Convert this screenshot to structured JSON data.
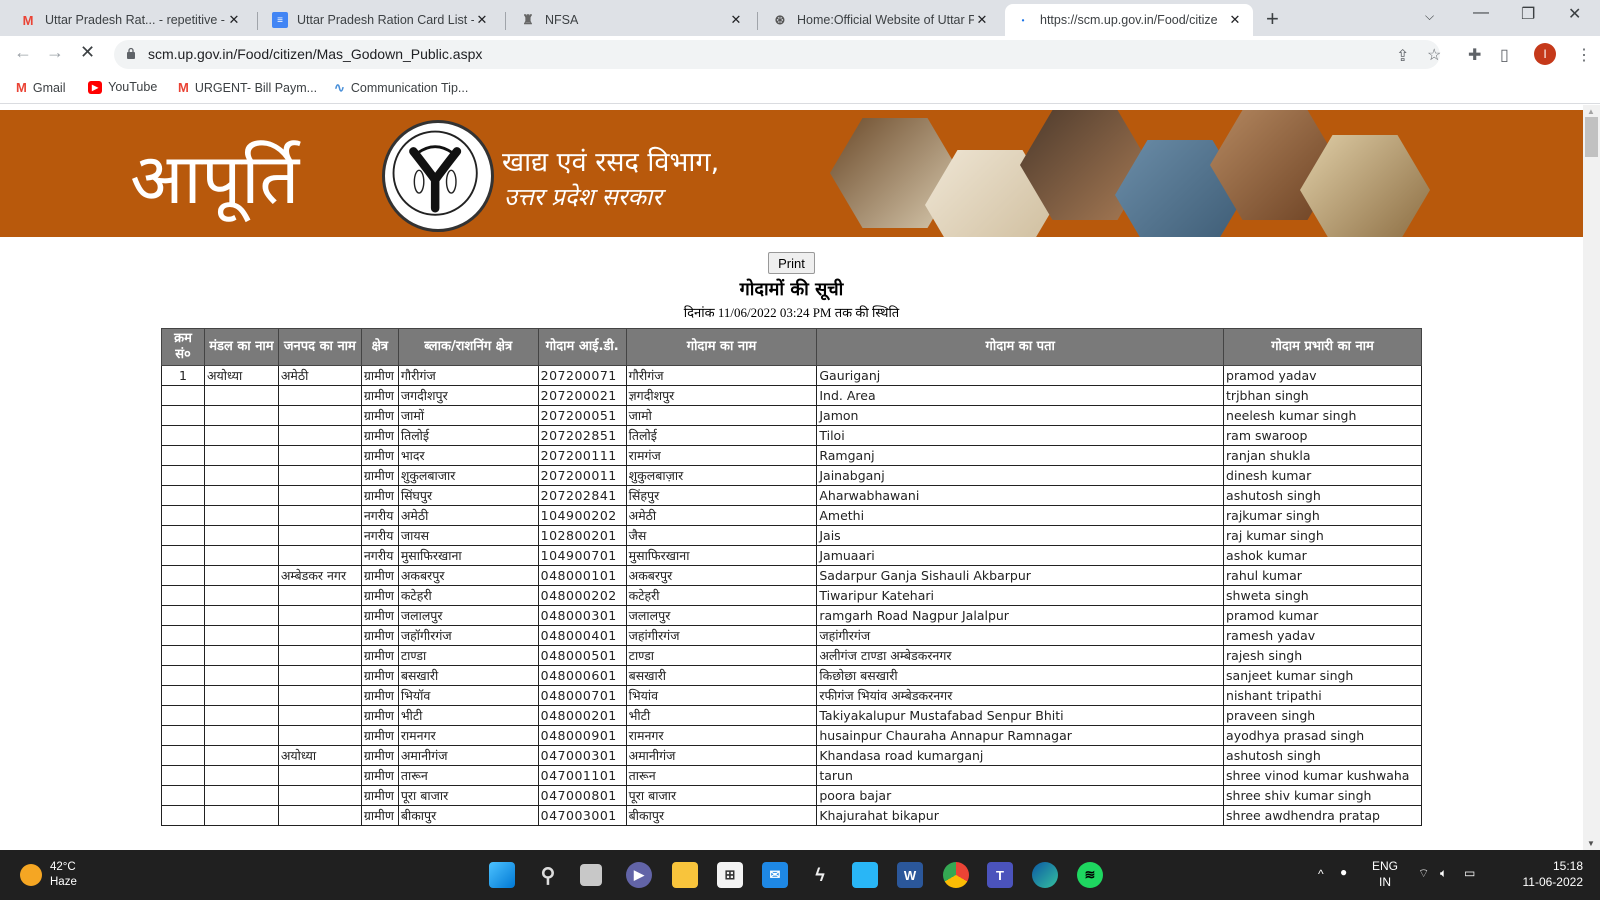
{
  "browser": {
    "tabs": [
      {
        "title": "Uttar Pradesh Rat... - repetitive -",
        "icon": "gmail-icon",
        "active": false
      },
      {
        "title": "Uttar Pradesh Ration Card List - (",
        "icon": "docs-icon",
        "active": false
      },
      {
        "title": "NFSA",
        "icon": "emblem-icon",
        "active": false
      },
      {
        "title": "Home:Official Website of Uttar Pr",
        "icon": "up-emblem-icon",
        "active": false
      },
      {
        "title": "https://scm.up.gov.in/Food/citize",
        "icon": "loading-icon",
        "active": true
      }
    ],
    "new_tab": "+",
    "url": "scm.up.gov.in/Food/citizen/Mas_Godown_Public.aspx",
    "profile_initial": "I",
    "bookmarks": [
      {
        "label": "Gmail",
        "icon": "gmail-icon"
      },
      {
        "label": "YouTube",
        "icon": "youtube-icon"
      },
      {
        "label": "URGENT- Bill Paym...",
        "icon": "gmail-icon"
      },
      {
        "label": "Communication Tip...",
        "icon": "chart-icon"
      }
    ]
  },
  "banner": {
    "brand": "आपूर्ति",
    "dept_line1": "खाद्य एवं रसद विभाग,",
    "dept_line2": "उत्तर प्रदेश सरकार",
    "color": "#b8590c"
  },
  "page": {
    "print_label": "Print",
    "title": "गोदामों की सूची",
    "subtitle": "दिनांक 11/06/2022 03:24 PM तक की स्थिति"
  },
  "table": {
    "headers": [
      "क्रम सं०",
      "मंडल का नाम",
      "जनपद का नाम",
      "क्षेत्र",
      "ब्लाक/राशनिंग क्षेत्र",
      "गोदाम आई.डी.",
      "गोदाम का नाम",
      "गोदाम का पता",
      "गोदाम प्रभारी का नाम"
    ],
    "rows": [
      [
        "1",
        "अयोध्या",
        "अमेठी",
        "ग्रामीण",
        "गौरीगंज",
        "207200071",
        "गौरीगंज",
        "Gauriganj",
        "pramod yadav"
      ],
      [
        "",
        "",
        "",
        "ग्रामीण",
        "जगदीशपुर",
        "207200021",
        "ज्ञगदीशपुर",
        "Ind. Area",
        "trjbhan singh"
      ],
      [
        "",
        "",
        "",
        "ग्रामीण",
        "जामों",
        "207200051",
        "जामो",
        "Jamon",
        "neelesh kumar singh"
      ],
      [
        "",
        "",
        "",
        "ग्रामीण",
        "तिलोई",
        "207202851",
        "तिलोई",
        "Tiloi",
        "ram swaroop"
      ],
      [
        "",
        "",
        "",
        "ग्रामीण",
        "भादर",
        "207200111",
        "रामगंज",
        "Ramganj",
        "ranjan shukla"
      ],
      [
        "",
        "",
        "",
        "ग्रामीण",
        "शुकुलबाजार",
        "207200011",
        "शुकुलबाज़ार",
        "Jainabganj",
        "dinesh kumar"
      ],
      [
        "",
        "",
        "",
        "ग्रामीण",
        "सिंघपुर",
        "207202841",
        "सिंहपुर",
        "Aharwabhawani",
        "ashutosh singh"
      ],
      [
        "",
        "",
        "",
        "नगरीय",
        "अमेठी",
        "104900202",
        "अमेठी",
        "Amethi",
        "rajkumar singh"
      ],
      [
        "",
        "",
        "",
        "नगरीय",
        "जायस",
        "102800201",
        "जैस",
        "Jais",
        "raj kumar singh"
      ],
      [
        "",
        "",
        "",
        "नगरीय",
        "मुसाफिरखाना",
        "104900701",
        "मुसाफिरखाना",
        "Jamuaari",
        "ashok kumar"
      ],
      [
        "",
        "",
        "अम्बेडकर नगर",
        "ग्रामीण",
        "अकबरपुर",
        "048000101",
        "अकबरपुर",
        "Sadarpur Ganja Sishauli Akbarpur",
        "rahul kumar"
      ],
      [
        "",
        "",
        "",
        "ग्रामीण",
        "कटेहरी",
        "048000202",
        "कटेहरी",
        "Tiwaripur Katehari",
        "shweta singh"
      ],
      [
        "",
        "",
        "",
        "ग्रामीण",
        "जलालपुर",
        "048000301",
        "जलालपुर",
        "ramgarh Road Nagpur Jalalpur",
        "pramod kumar"
      ],
      [
        "",
        "",
        "",
        "ग्रामीण",
        "जहॉगीरगंज",
        "048000401",
        "जहांगीरगंज",
        "जहांगीरगंज",
        "ramesh yadav"
      ],
      [
        "",
        "",
        "",
        "ग्रामीण",
        "टाण्डा",
        "048000501",
        "टाण्डा",
        "अलीगंज टाण्डा अम्बेडकरनगर",
        "rajesh singh"
      ],
      [
        "",
        "",
        "",
        "ग्रामीण",
        "बसखारी",
        "048000601",
        "बसखारी",
        "किछोछा बसखारी",
        "sanjeet kumar singh"
      ],
      [
        "",
        "",
        "",
        "ग्रामीण",
        "भियॉव",
        "048000701",
        "भियांव",
        "रफीगंज भियांव अम्बेडकरनगर",
        "nishant tripathi"
      ],
      [
        "",
        "",
        "",
        "ग्रामीण",
        "भीटी",
        "048000201",
        "भीटी",
        "Takiyakalupur Mustafabad Senpur Bhiti",
        "praveen singh"
      ],
      [
        "",
        "",
        "",
        "ग्रामीण",
        "रामनगर",
        "048000901",
        "रामनगर",
        "husainpur Chauraha Annapur Ramnagar",
        "ayodhya prasad singh"
      ],
      [
        "",
        "",
        "अयोध्या",
        "ग्रामीण",
        "अमानीगंज",
        "047000301",
        "अमानीगंज",
        "Khandasa road kumarganj",
        "ashutosh singh"
      ],
      [
        "",
        "",
        "",
        "ग्रामीण",
        "तारून",
        "047001101",
        "तारून",
        "tarun",
        "shree vinod kumar kushwaha"
      ],
      [
        "",
        "",
        "",
        "ग्रामीण",
        "पूरा बाजार",
        "047000801",
        "पूरा बाजार",
        "poora bajar",
        "shree shiv kumar singh"
      ],
      [
        "",
        "",
        "",
        "ग्रामीण",
        "बीकापुर",
        "047003001",
        "बीकापुर",
        "Khajurahat bikapur",
        "shree awdhendra pratap"
      ]
    ]
  },
  "taskbar": {
    "weather_temp": "42°C",
    "weather_desc": "Haze",
    "lang_line1": "ENG",
    "lang_line2": "IN",
    "time": "15:18",
    "date": "11-06-2022",
    "apps": [
      "start-icon",
      "search-icon",
      "task-view-icon",
      "teams-chat-icon",
      "file-explorer-icon",
      "store-icon",
      "mail-icon",
      "app-icon",
      "desktop-icon",
      "word-icon",
      "chrome-icon",
      "teams-icon",
      "edge-icon",
      "spotify-icon"
    ]
  }
}
